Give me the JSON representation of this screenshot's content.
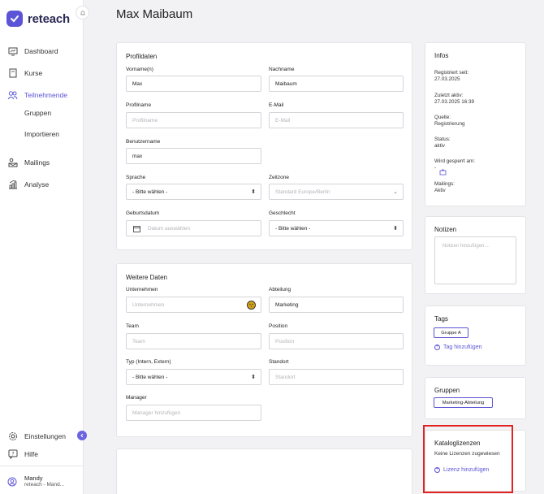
{
  "app": {
    "name": "reteach"
  },
  "sidebar": {
    "items": [
      {
        "label": "Dashboard"
      },
      {
        "label": "Kurse"
      },
      {
        "label": "Teilnehmende"
      },
      {
        "label": "Gruppen"
      },
      {
        "label": "Importieren"
      },
      {
        "label": "Mailings"
      },
      {
        "label": "Analyse"
      }
    ],
    "bottom": [
      {
        "label": "Einstellungen"
      },
      {
        "label": "Hilfe"
      }
    ],
    "user": {
      "name": "Mandy",
      "org": "reteach - Mand..."
    }
  },
  "page": {
    "title": "Max Maibaum"
  },
  "profile": {
    "title": "Profildaten",
    "vorname": {
      "label": "Vorname(n)",
      "value": "Max"
    },
    "nachname": {
      "label": "Nachname",
      "value": "Maibaum"
    },
    "profilname": {
      "label": "Profilname",
      "placeholder": "Profilname"
    },
    "email": {
      "label": "E-Mail",
      "placeholder": "E-Mail"
    },
    "benutzername": {
      "label": "Benutzername",
      "value": "max"
    },
    "sprache": {
      "label": "Sprache",
      "value": "- Bitte wählen -"
    },
    "zeitzone": {
      "label": "Zeitzone",
      "value": "Standard Europe/Berlin"
    },
    "geburtsdatum": {
      "label": "Geburtsdatum",
      "placeholder": "Datum auswählen"
    },
    "geschlecht": {
      "label": "Geschlecht",
      "value": "- Bitte wählen -"
    }
  },
  "more": {
    "title": "Weitere Daten",
    "unternehmen": {
      "label": "Unternehmen",
      "placeholder": "Unternehmen"
    },
    "abteilung": {
      "label": "Abteilung",
      "value": "Marketing"
    },
    "team": {
      "label": "Team",
      "placeholder": "Team"
    },
    "position": {
      "label": "Position",
      "placeholder": "Position"
    },
    "typ": {
      "label": "Typ (Intern, Extern)",
      "value": "- Bitte wählen -"
    },
    "standort": {
      "label": "Standort",
      "placeholder": "Standort"
    },
    "manager": {
      "label": "Manager",
      "placeholder": "Manager hinzufügen"
    }
  },
  "infos": {
    "title": "Infos",
    "registriert_label": "Registriert seit:",
    "registriert_value": "27.03.2025",
    "aktiv_label": "Zuletzt aktiv:",
    "aktiv_value": "27.03.2025 16:39",
    "quelle_label": "Quelle:",
    "quelle_value": "Registrierung",
    "status_label": "Status:",
    "status_value": "aktiv",
    "gesperrt_label": "Wird gesperrt am:",
    "gesperrt_value": "-",
    "mailings_label": "Mailings:",
    "mailings_value": "Aktiv"
  },
  "notizen": {
    "title": "Notizen",
    "placeholder": "Notizen hinzufügen ..."
  },
  "tags": {
    "title": "Tags",
    "chip": "Gruppe A",
    "add": "Tag hinzufügen"
  },
  "gruppen": {
    "title": "Gruppen",
    "chip": "Marketing-Abteilung"
  },
  "lizenzen": {
    "title": "Kataloglizenzen",
    "empty": "Keine Lizenzen zugewiesen",
    "add": "Lizenz hinzufügen"
  },
  "colors": {
    "accent": "#5b54d6",
    "highlight": "#e02424"
  }
}
